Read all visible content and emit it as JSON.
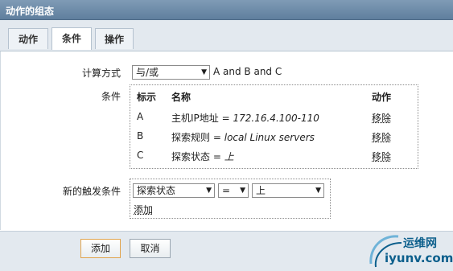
{
  "window": {
    "title": "动作的组态"
  },
  "tabs": [
    {
      "label": "动作"
    },
    {
      "label": "条件"
    },
    {
      "label": "操作"
    }
  ],
  "calc": {
    "label": "计算方式",
    "selected": "与/或",
    "expression": "A and B and C"
  },
  "conditions": {
    "label": "条件",
    "headers": {
      "tag": "标示",
      "name": "名称",
      "action": "动作"
    },
    "rows": [
      {
        "tag": "A",
        "field": "主机IP地址",
        "op": "=",
        "value": "172.16.4.100-110",
        "action": "移除"
      },
      {
        "tag": "B",
        "field": "探索规则",
        "op": "=",
        "value": "local Linux servers",
        "action": "移除"
      },
      {
        "tag": "C",
        "field": "探索状态",
        "op": "=",
        "value": "上",
        "action": "移除"
      }
    ]
  },
  "new_condition": {
    "label": "新的触发条件",
    "type_selected": "探索状态",
    "op_selected": "=",
    "value_selected": "上",
    "add_link": "添加"
  },
  "footer": {
    "add_label": "添加",
    "cancel_label": "取消"
  },
  "watermark": {
    "cn": "运维网",
    "en": "iyunv.com"
  },
  "colors": {
    "accent_border": "#e1a44d",
    "header": "#5f7f9e",
    "logo": "#0c5f8c"
  }
}
